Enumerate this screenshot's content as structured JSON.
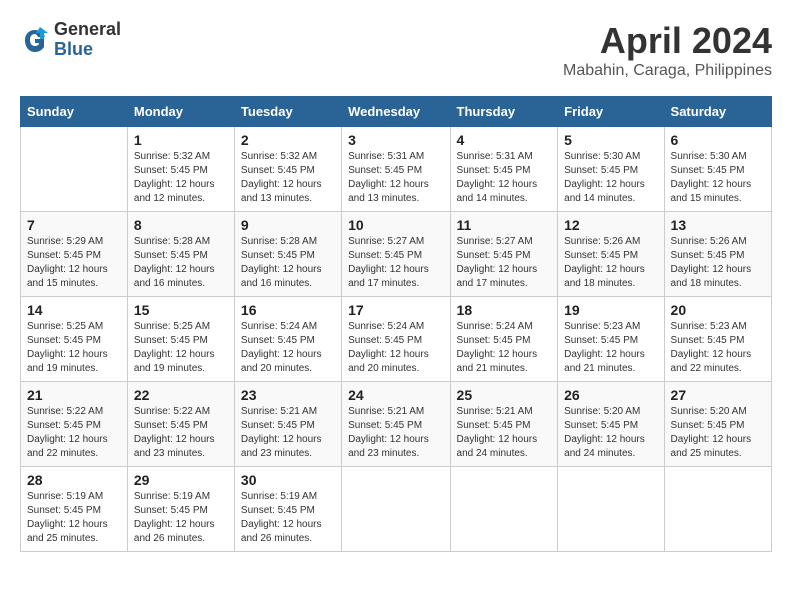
{
  "logo": {
    "general": "General",
    "blue": "Blue"
  },
  "title": "April 2024",
  "subtitle": "Mabahin, Caraga, Philippines",
  "headers": [
    "Sunday",
    "Monday",
    "Tuesday",
    "Wednesday",
    "Thursday",
    "Friday",
    "Saturday"
  ],
  "weeks": [
    [
      {
        "day": "",
        "sunrise": "",
        "sunset": "",
        "daylight": ""
      },
      {
        "day": "1",
        "sunrise": "Sunrise: 5:32 AM",
        "sunset": "Sunset: 5:45 PM",
        "daylight": "Daylight: 12 hours and 12 minutes."
      },
      {
        "day": "2",
        "sunrise": "Sunrise: 5:32 AM",
        "sunset": "Sunset: 5:45 PM",
        "daylight": "Daylight: 12 hours and 13 minutes."
      },
      {
        "day": "3",
        "sunrise": "Sunrise: 5:31 AM",
        "sunset": "Sunset: 5:45 PM",
        "daylight": "Daylight: 12 hours and 13 minutes."
      },
      {
        "day": "4",
        "sunrise": "Sunrise: 5:31 AM",
        "sunset": "Sunset: 5:45 PM",
        "daylight": "Daylight: 12 hours and 14 minutes."
      },
      {
        "day": "5",
        "sunrise": "Sunrise: 5:30 AM",
        "sunset": "Sunset: 5:45 PM",
        "daylight": "Daylight: 12 hours and 14 minutes."
      },
      {
        "day": "6",
        "sunrise": "Sunrise: 5:30 AM",
        "sunset": "Sunset: 5:45 PM",
        "daylight": "Daylight: 12 hours and 15 minutes."
      }
    ],
    [
      {
        "day": "7",
        "sunrise": "Sunrise: 5:29 AM",
        "sunset": "Sunset: 5:45 PM",
        "daylight": "Daylight: 12 hours and 15 minutes."
      },
      {
        "day": "8",
        "sunrise": "Sunrise: 5:28 AM",
        "sunset": "Sunset: 5:45 PM",
        "daylight": "Daylight: 12 hours and 16 minutes."
      },
      {
        "day": "9",
        "sunrise": "Sunrise: 5:28 AM",
        "sunset": "Sunset: 5:45 PM",
        "daylight": "Daylight: 12 hours and 16 minutes."
      },
      {
        "day": "10",
        "sunrise": "Sunrise: 5:27 AM",
        "sunset": "Sunset: 5:45 PM",
        "daylight": "Daylight: 12 hours and 17 minutes."
      },
      {
        "day": "11",
        "sunrise": "Sunrise: 5:27 AM",
        "sunset": "Sunset: 5:45 PM",
        "daylight": "Daylight: 12 hours and 17 minutes."
      },
      {
        "day": "12",
        "sunrise": "Sunrise: 5:26 AM",
        "sunset": "Sunset: 5:45 PM",
        "daylight": "Daylight: 12 hours and 18 minutes."
      },
      {
        "day": "13",
        "sunrise": "Sunrise: 5:26 AM",
        "sunset": "Sunset: 5:45 PM",
        "daylight": "Daylight: 12 hours and 18 minutes."
      }
    ],
    [
      {
        "day": "14",
        "sunrise": "Sunrise: 5:25 AM",
        "sunset": "Sunset: 5:45 PM",
        "daylight": "Daylight: 12 hours and 19 minutes."
      },
      {
        "day": "15",
        "sunrise": "Sunrise: 5:25 AM",
        "sunset": "Sunset: 5:45 PM",
        "daylight": "Daylight: 12 hours and 19 minutes."
      },
      {
        "day": "16",
        "sunrise": "Sunrise: 5:24 AM",
        "sunset": "Sunset: 5:45 PM",
        "daylight": "Daylight: 12 hours and 20 minutes."
      },
      {
        "day": "17",
        "sunrise": "Sunrise: 5:24 AM",
        "sunset": "Sunset: 5:45 PM",
        "daylight": "Daylight: 12 hours and 20 minutes."
      },
      {
        "day": "18",
        "sunrise": "Sunrise: 5:24 AM",
        "sunset": "Sunset: 5:45 PM",
        "daylight": "Daylight: 12 hours and 21 minutes."
      },
      {
        "day": "19",
        "sunrise": "Sunrise: 5:23 AM",
        "sunset": "Sunset: 5:45 PM",
        "daylight": "Daylight: 12 hours and 21 minutes."
      },
      {
        "day": "20",
        "sunrise": "Sunrise: 5:23 AM",
        "sunset": "Sunset: 5:45 PM",
        "daylight": "Daylight: 12 hours and 22 minutes."
      }
    ],
    [
      {
        "day": "21",
        "sunrise": "Sunrise: 5:22 AM",
        "sunset": "Sunset: 5:45 PM",
        "daylight": "Daylight: 12 hours and 22 minutes."
      },
      {
        "day": "22",
        "sunrise": "Sunrise: 5:22 AM",
        "sunset": "Sunset: 5:45 PM",
        "daylight": "Daylight: 12 hours and 23 minutes."
      },
      {
        "day": "23",
        "sunrise": "Sunrise: 5:21 AM",
        "sunset": "Sunset: 5:45 PM",
        "daylight": "Daylight: 12 hours and 23 minutes."
      },
      {
        "day": "24",
        "sunrise": "Sunrise: 5:21 AM",
        "sunset": "Sunset: 5:45 PM",
        "daylight": "Daylight: 12 hours and 23 minutes."
      },
      {
        "day": "25",
        "sunrise": "Sunrise: 5:21 AM",
        "sunset": "Sunset: 5:45 PM",
        "daylight": "Daylight: 12 hours and 24 minutes."
      },
      {
        "day": "26",
        "sunrise": "Sunrise: 5:20 AM",
        "sunset": "Sunset: 5:45 PM",
        "daylight": "Daylight: 12 hours and 24 minutes."
      },
      {
        "day": "27",
        "sunrise": "Sunrise: 5:20 AM",
        "sunset": "Sunset: 5:45 PM",
        "daylight": "Daylight: 12 hours and 25 minutes."
      }
    ],
    [
      {
        "day": "28",
        "sunrise": "Sunrise: 5:19 AM",
        "sunset": "Sunset: 5:45 PM",
        "daylight": "Daylight: 12 hours and 25 minutes."
      },
      {
        "day": "29",
        "sunrise": "Sunrise: 5:19 AM",
        "sunset": "Sunset: 5:45 PM",
        "daylight": "Daylight: 12 hours and 26 minutes."
      },
      {
        "day": "30",
        "sunrise": "Sunrise: 5:19 AM",
        "sunset": "Sunset: 5:45 PM",
        "daylight": "Daylight: 12 hours and 26 minutes."
      },
      {
        "day": "",
        "sunrise": "",
        "sunset": "",
        "daylight": ""
      },
      {
        "day": "",
        "sunrise": "",
        "sunset": "",
        "daylight": ""
      },
      {
        "day": "",
        "sunrise": "",
        "sunset": "",
        "daylight": ""
      },
      {
        "day": "",
        "sunrise": "",
        "sunset": "",
        "daylight": ""
      }
    ]
  ]
}
